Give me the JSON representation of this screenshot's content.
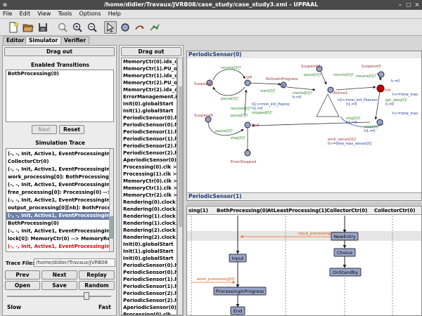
{
  "window": {
    "title": "/home/didier/Travaux/JVRB08/case_study/case_study3.xml - UPPAAL",
    "menu_glyph": "o"
  },
  "menu": [
    "File",
    "Edit",
    "View",
    "Tools",
    "Options",
    "Help"
  ],
  "tabs": [
    "Editor",
    "Simulator",
    "Verifier"
  ],
  "left_panel": {
    "drag_out": "Drag out",
    "enabled_transitions_label": "Enabled Transitions",
    "enabled_transitions": [
      "BothProcessing(0)"
    ],
    "next_label": "Next",
    "reset_label": "Reset",
    "simulation_trace_label": "Simulation Trace",
    "trace": [
      {
        "text": "(-, -, Init, Active1, EventProcessingInP",
        "style": "normal"
      },
      {
        "text": "CollectorCtr(0)",
        "style": "normal"
      },
      {
        "text": "(-, -, Init, Active1, EventProcessingInP",
        "style": "normal"
      },
      {
        "text": "work_processing[0]: BothProcessing(0",
        "style": "normal"
      },
      {
        "text": "(-, -, Init, Active1, EventProcessingInP",
        "style": "normal"
      },
      {
        "text": "free_processing[0]: Processing(0) -->",
        "style": "normal"
      },
      {
        "text": "(-, -, Init, Active1, EventProcessingInP",
        "style": "normal"
      },
      {
        "text": "output_processing[0][nb]: BothProcess",
        "style": "normal"
      },
      {
        "text": "(-, -, Init, Active1, EventProcessingInP",
        "style": "sel"
      },
      {
        "text": "BothProcessing(0)",
        "style": "normal"
      },
      {
        "text": "(-, -, Init, Active1, EventProcessingInP",
        "style": "normal"
      },
      {
        "text": "lock[0]: MemoryCtr(0) --> MemoryRec",
        "style": "normal"
      },
      {
        "text": "(-, -, Init, Active1, EventProcessingInP",
        "style": "red"
      }
    ],
    "trace_file_label": "Trace File:",
    "trace_file_value": "/home/didier/Travaux/JVRB08",
    "prev_label": "Prev",
    "next2_label": "Next",
    "replay_label": "Replay",
    "open_label": "Open",
    "save_label": "Save",
    "random_label": "Random",
    "speed_level": 0.78,
    "slow_label": "Slow",
    "fast_label": "Fast"
  },
  "middle_panel": {
    "drag_out": "Drag out",
    "variables": [
      "MemoryCtr(0).idx_o",
      "MemoryCtr(1).PU_o",
      "MemoryCtr(1).idx_o",
      "MemoryCtr(2).PU_o",
      "MemoryCtr(2).idx_o",
      "ErrorManagement.it",
      "Init(0).globalStart",
      "Init(1).globalStart",
      "PeriodicSensor(0).h",
      "PeriodicSensor(0).h",
      "PeriodicSensor(1).h",
      "PeriodicSensor(1).h",
      "PeriodicSensor(2).h",
      "PeriodicSensor(2).h",
      "AperiodicSensor(0).",
      "Processing(0).clk >",
      "Processing(1).clk >",
      "MemoryCtr(0).clk >",
      "MemoryCtr(1).clk >",
      "MemoryCtr(2).clk >",
      "Rendering(0).clock1",
      "Rendering(0).clock2",
      "Rendering(1).clock1",
      "Rendering(1).clock2",
      "Rendering(2).clock1",
      "Rendering(2).clock2",
      "Init(0).globalStart",
      "Init(1).globalStart",
      "Init(0).globalStart",
      "PeriodicSensor(0).h",
      "PeriodicSensor(0).h",
      "PeriodicSensor(1).h",
      "PeriodicSensor(1).h",
      "PeriodicSensor(2).h",
      "PeriodicSensor(2).h",
      "AperiodicSensor(0).",
      "Processing(0).clk",
      "Processing(1).clk"
    ]
  },
  "automaton": {
    "header0": "PeriodicSensor(0)",
    "header1": "PeriodicSensor(1)",
    "states": {
      "suspend1": "Suspend1",
      "off": "Off",
      "active_in_progress": "ActiveInProgress",
      "suspend2": "Suspend2",
      "active1": "Active1",
      "suspend3": "Suspend3",
      "init": "Init",
      "suspend5": "Suspend5",
      "end": "End",
      "error_stopped": "ErrorStopped"
    },
    "labels": {
      "resume1": "resume[0]?",
      "pause1": "pause[0]?",
      "start": "start[0]?",
      "started": "started[0]?",
      "h_zero_a": "h:=0",
      "pause2": "pause[0]?",
      "resume2": "resume[0]?",
      "resume3": "resume[0]?",
      "h_zero_b": "h:=0",
      "h_time_max": "h<=time_max",
      "h_min": "h1>=min_init_Pserso",
      "h_zero_c": "h1:=0",
      "h2": "h2>=min_init_Psensor",
      "h_zero_d": "h1:=0",
      "get_data": "get_data[0]!",
      "h_zero_e": "h:=0",
      "h_time_max2": "h<=time_max",
      "resume4": "resume[0]?",
      "pause3": "pause[0]?",
      "h1_range": "h1>=min_sensor_0",
      "stopped": "stopped[0]!",
      "stop1": "stop[0]?",
      "h_zero_f": "h1:=0",
      "stop2": "stop[0]?",
      "h_zero_g": "h1:=0",
      "pause4": "pause[0]?",
      "stop3": "stop[0]?",
      "error_sensor": "error_sensor[0]!",
      "h_time_max3": "h>=time_max_sensor[0]"
    }
  },
  "msc": {
    "columns": [
      "sing(1)",
      "BothProcessing(0)",
      "AtLeastProcessing(1)",
      "CollectorCtr(0)",
      "CollectorCtr(0)"
    ],
    "states": {
      "new_entry": "NewEntry",
      "choice": "Choice",
      "on_standby": "OnStandby",
      "input": "Input",
      "processing_in_progress": "ProcessingInProgress",
      "end": "End"
    },
    "messages": {
      "input_processing": "input_processing[i][N]",
      "work_processing": "work_processing[0]"
    }
  },
  "colors": {
    "accent": "#6e80a8",
    "trace_red": "#d00000",
    "state_fill": "#9aa6c8",
    "init_state": "#c00000",
    "arrow_orange": "#ff6a1a",
    "label_green": "#2a8a2a",
    "label_blue": "#1a3a9a"
  }
}
